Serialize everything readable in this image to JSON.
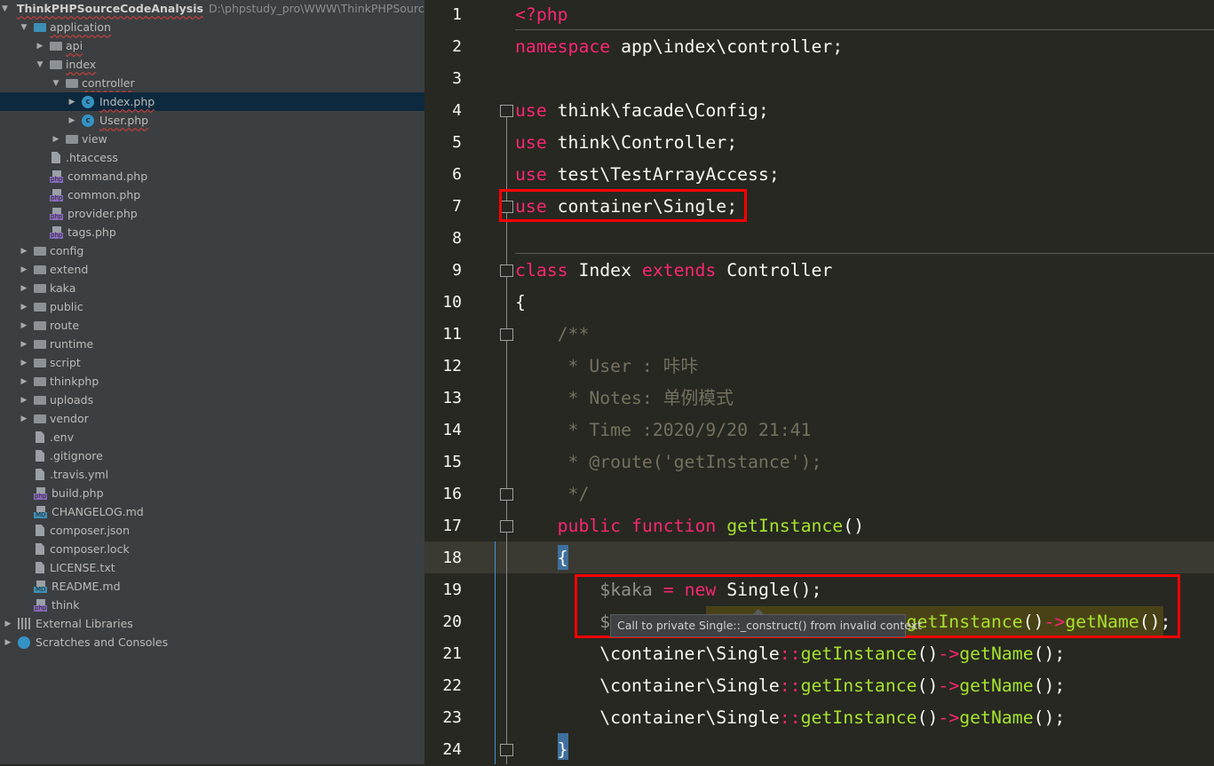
{
  "project_tree": {
    "root": {
      "name": "ThinkPHPSourceCodeAnalysis",
      "path": "D:\\phpstudy_pro\\WWW\\ThinkPHPSourceCo"
    },
    "items": [
      {
        "label": "application",
        "icon": "folder-icon"
      },
      {
        "label": "api",
        "icon": "folder-icon"
      },
      {
        "label": "index",
        "icon": "folder-icon"
      },
      {
        "label": "controller",
        "icon": "folder-icon"
      },
      {
        "label": "Index.php",
        "icon": "php-class-icon",
        "selected": true
      },
      {
        "label": "User.php",
        "icon": "php-class-icon"
      },
      {
        "label": "view",
        "icon": "folder-icon"
      },
      {
        "label": ".htaccess",
        "icon": "htaccess-icon"
      },
      {
        "label": "command.php",
        "icon": "php-file-icon"
      },
      {
        "label": "common.php",
        "icon": "php-file-icon"
      },
      {
        "label": "provider.php",
        "icon": "php-file-icon"
      },
      {
        "label": "tags.php",
        "icon": "php-file-icon"
      },
      {
        "label": "config",
        "icon": "folder-icon"
      },
      {
        "label": "extend",
        "icon": "folder-icon"
      },
      {
        "label": "kaka",
        "icon": "folder-icon"
      },
      {
        "label": "public",
        "icon": "folder-icon"
      },
      {
        "label": "route",
        "icon": "folder-icon"
      },
      {
        "label": "runtime",
        "icon": "folder-icon"
      },
      {
        "label": "script",
        "icon": "folder-icon"
      },
      {
        "label": "thinkphp",
        "icon": "folder-icon"
      },
      {
        "label": "uploads",
        "icon": "folder-icon"
      },
      {
        "label": "vendor",
        "icon": "folder-icon"
      },
      {
        "label": ".env",
        "icon": "text-file-icon"
      },
      {
        "label": ".gitignore",
        "icon": "text-file-icon"
      },
      {
        "label": ".travis.yml",
        "icon": "yaml-file-icon"
      },
      {
        "label": "build.php",
        "icon": "php-file-icon"
      },
      {
        "label": "CHANGELOG.md",
        "icon": "markdown-file-icon"
      },
      {
        "label": "composer.json",
        "icon": "json-file-icon"
      },
      {
        "label": "composer.lock",
        "icon": "json-file-icon"
      },
      {
        "label": "LICENSE.txt",
        "icon": "text-file-icon"
      },
      {
        "label": "README.md",
        "icon": "markdown-file-icon"
      },
      {
        "label": "think",
        "icon": "php-file-icon"
      },
      {
        "label": "External Libraries",
        "icon": "libraries-icon"
      },
      {
        "label": "Scratches and Consoles",
        "icon": "scratches-icon"
      }
    ]
  },
  "editor": {
    "lines": [
      [
        [
          "kw",
          "<?php"
        ]
      ],
      [
        [
          "kw",
          "namespace"
        ],
        [
          "tx",
          " app\\index\\controller;"
        ]
      ],
      [],
      [
        [
          "kw",
          "use"
        ],
        [
          "tx",
          " think\\facade\\Config;"
        ]
      ],
      [
        [
          "kw",
          "use"
        ],
        [
          "tx",
          " think\\Controller;"
        ]
      ],
      [
        [
          "kw",
          "use"
        ],
        [
          "tx",
          " test\\TestArrayAccess;"
        ]
      ],
      [
        [
          "kw",
          "use"
        ],
        [
          "tx",
          " container\\Single;"
        ]
      ],
      [],
      [
        [
          "kw",
          "class"
        ],
        [
          "tx",
          " Index "
        ],
        [
          "kw",
          "extends"
        ],
        [
          "tx",
          " Controller"
        ]
      ],
      [
        [
          "tx",
          "{"
        ]
      ],
      [
        [
          "cm",
          "    /**"
        ]
      ],
      [
        [
          "cm",
          "     * User : 咔咔"
        ]
      ],
      [
        [
          "cm",
          "     * Notes: 单例模式"
        ]
      ],
      [
        [
          "cm",
          "     * Time :2020/9/20 21:41"
        ]
      ],
      [
        [
          "cm",
          "     * @route('getInstance');"
        ]
      ],
      [
        [
          "cm",
          "     */"
        ]
      ],
      [
        [
          "tx",
          "    "
        ],
        [
          "kw",
          "public function"
        ],
        [
          "tx",
          " "
        ],
        [
          "fn",
          "getInstance"
        ],
        [
          "tx",
          "()"
        ]
      ],
      [
        [
          "tx",
          "    {"
        ]
      ],
      [
        [
          "tx",
          "        "
        ],
        [
          "var",
          "$kaka"
        ],
        [
          "tx",
          " "
        ],
        [
          "op",
          "="
        ],
        [
          "tx",
          " "
        ],
        [
          "kw",
          "new"
        ],
        [
          "tx",
          " Single();"
        ]
      ],
      [
        [
          "tx",
          "        "
        ],
        [
          "var",
          "$"
        ],
        [
          "tx",
          "                            "
        ],
        [
          "fn",
          "getInstance"
        ],
        [
          "tx",
          "()"
        ],
        [
          "op",
          "->"
        ],
        [
          "fn",
          "getName"
        ],
        [
          "tx",
          "();"
        ]
      ],
      [
        [
          "tx",
          "        \\container\\Single"
        ],
        [
          "op",
          "::"
        ],
        [
          "fn",
          "getInstance"
        ],
        [
          "tx",
          "()"
        ],
        [
          "op",
          "->"
        ],
        [
          "fn",
          "getName"
        ],
        [
          "tx",
          "();"
        ]
      ],
      [
        [
          "tx",
          "        \\container\\Single"
        ],
        [
          "op",
          "::"
        ],
        [
          "fn",
          "getInstance"
        ],
        [
          "tx",
          "()"
        ],
        [
          "op",
          "->"
        ],
        [
          "fn",
          "getName"
        ],
        [
          "tx",
          "();"
        ]
      ],
      [
        [
          "tx",
          "        \\container\\Single"
        ],
        [
          "op",
          "::"
        ],
        [
          "fn",
          "getInstance"
        ],
        [
          "tx",
          "()"
        ],
        [
          "op",
          "->"
        ],
        [
          "fn",
          "getName"
        ],
        [
          "tx",
          "();"
        ]
      ],
      [
        [
          "tx",
          "    }"
        ]
      ]
    ],
    "current_line": 18,
    "tooltip": "Call to private Single::_construct() from invalid context"
  },
  "colors": {
    "keyword": "#f92672",
    "function": "#a6e22e",
    "comment": "#75715e",
    "annotation_box": "#ff0000"
  }
}
